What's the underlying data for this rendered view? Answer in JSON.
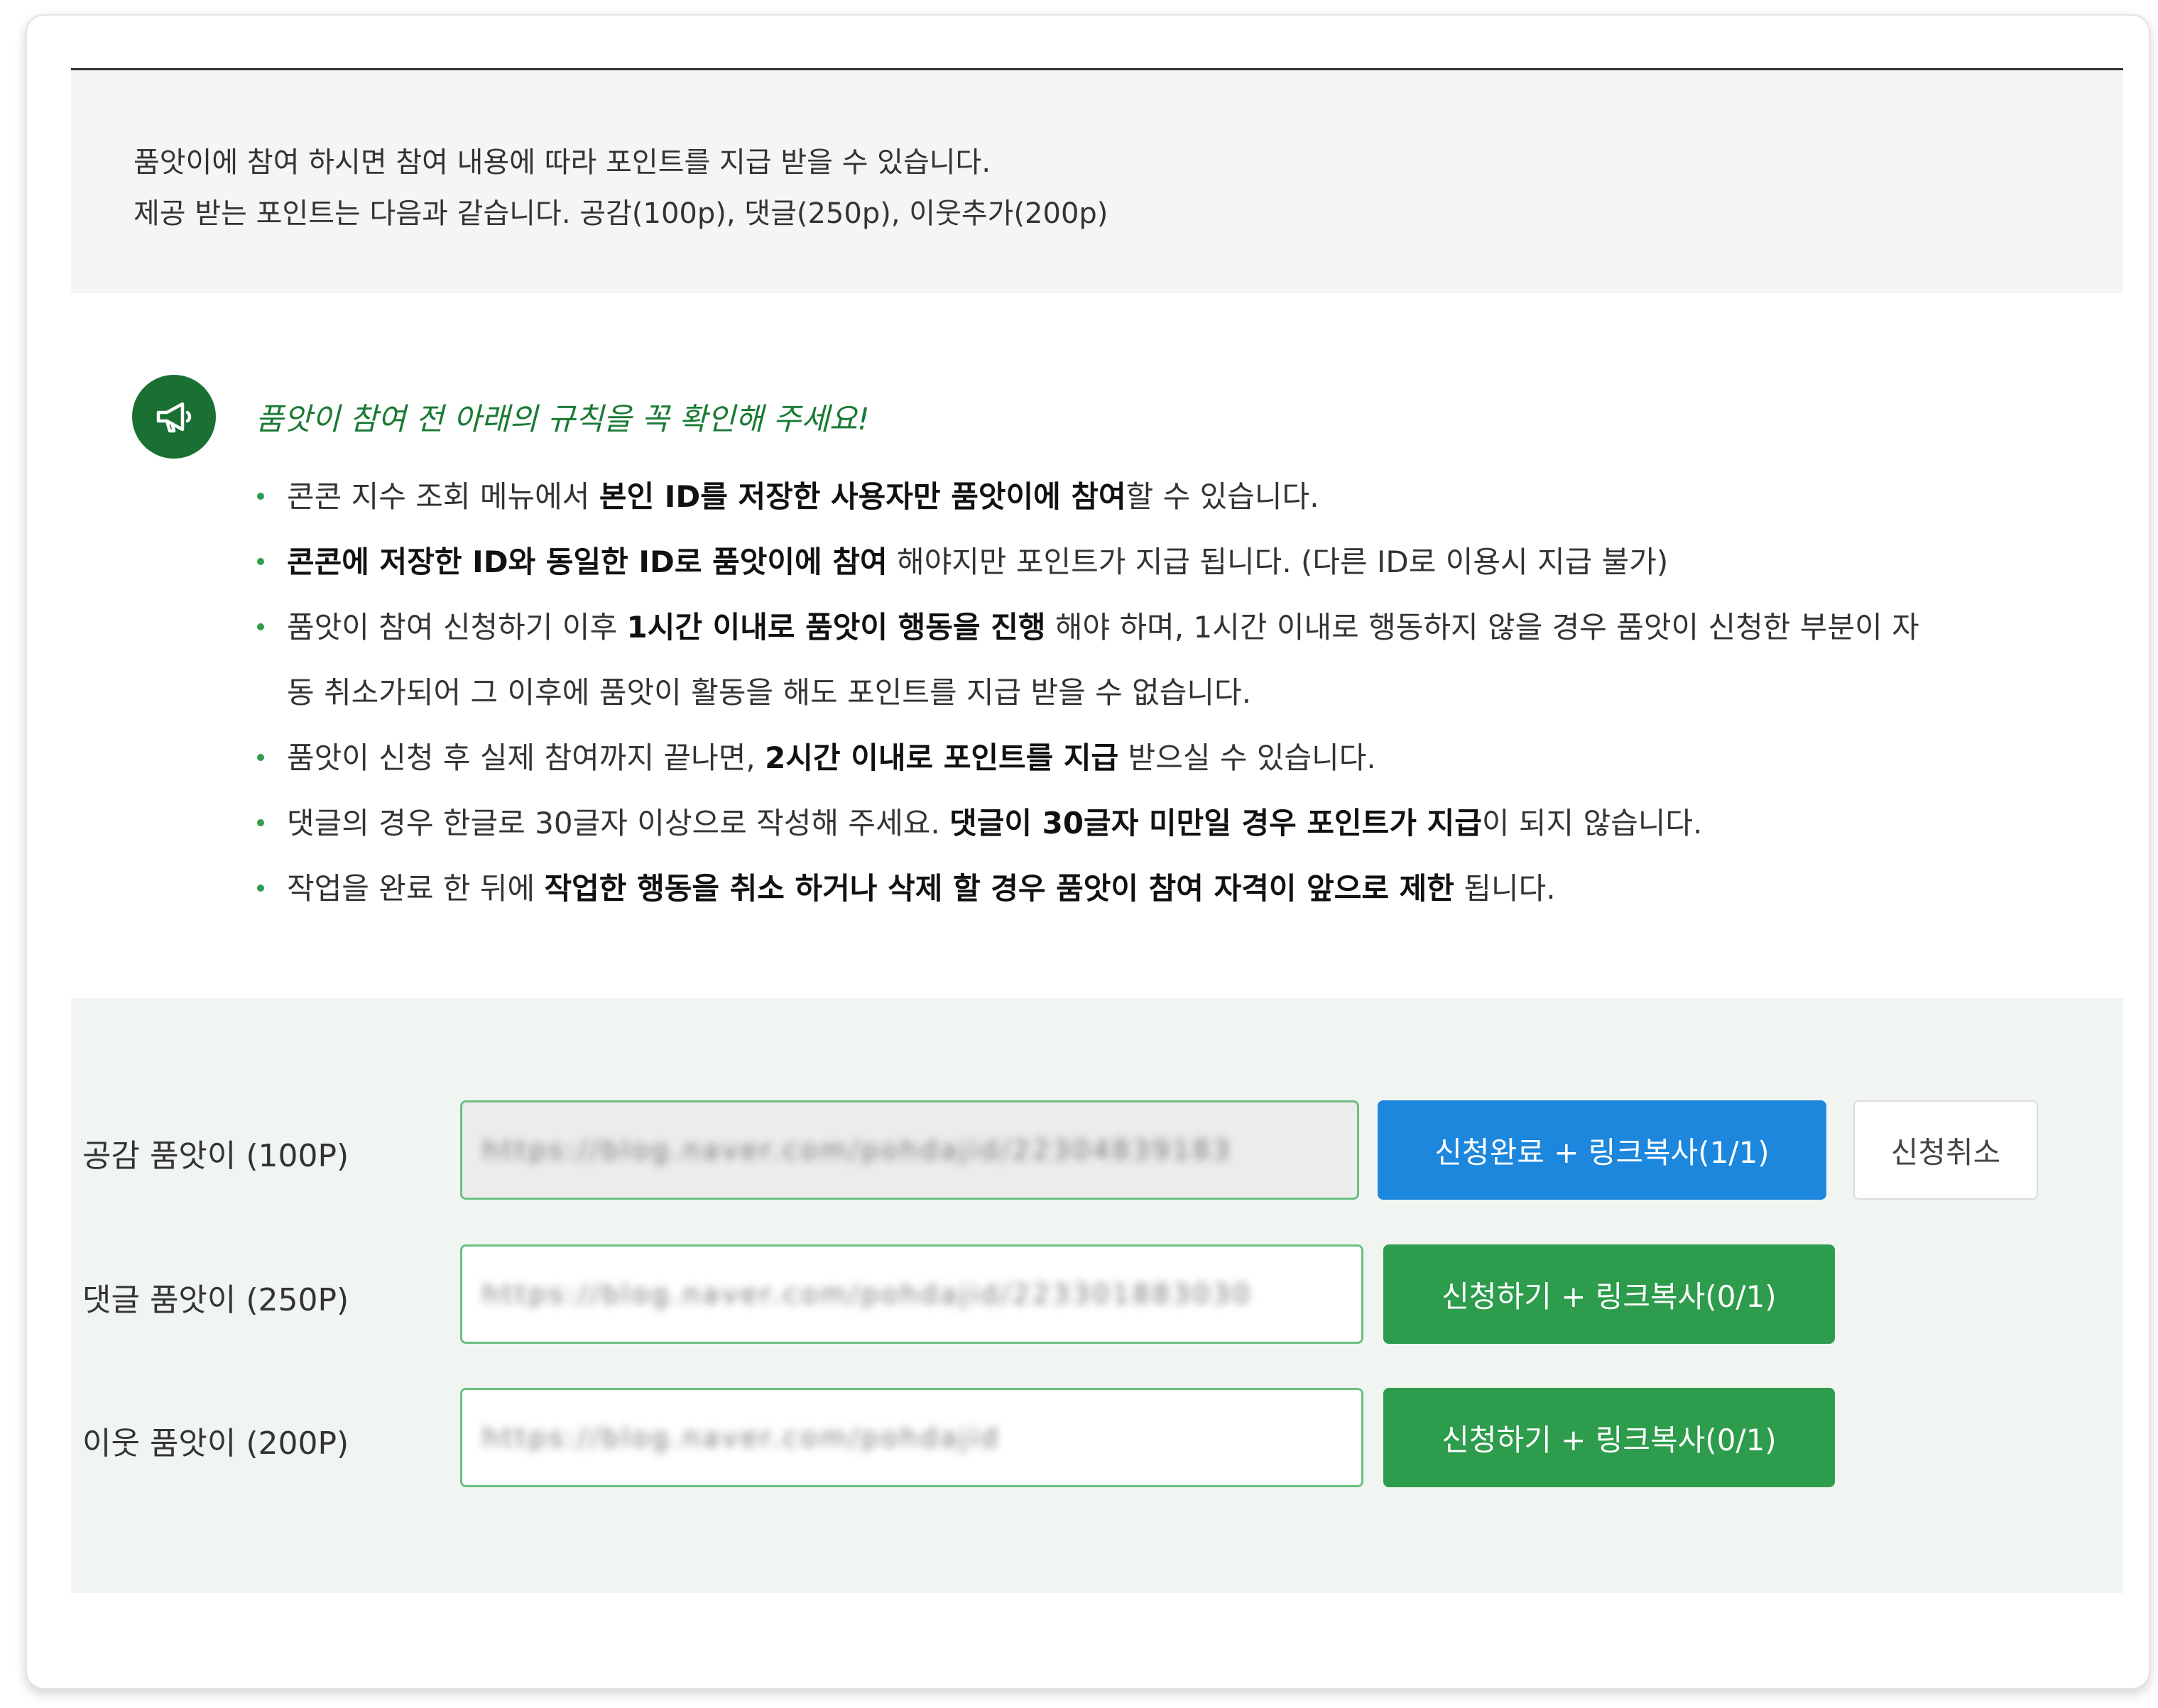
{
  "notice": {
    "line1": "품앗이에 참여 하시면 참여 내용에 따라 포인트를 지급 받을 수 있습니다.",
    "line2": "제공 받는 포인트는 다음과 같습니다. 공감(100p), 댓글(250p), 이웃추가(200p)"
  },
  "rules": {
    "title": "품앗이 참여 전 아래의 규칙을 꼭 확인해 주세요!",
    "icon": "megaphone-icon",
    "items": [
      [
        {
          "t": "콘콘 지수 조회 메뉴에서 ",
          "b": false
        },
        {
          "t": "본인 ID를 저장한 사용자만 품앗이에 참여",
          "b": true
        },
        {
          "t": "할 수 있습니다.",
          "b": false
        }
      ],
      [
        {
          "t": "콘콘에 저장한 ID와 동일한 ID로 품앗이에 참여",
          "b": true
        },
        {
          "t": " 해야지만 포인트가 지급 됩니다. (다른 ID로 이용시 지급 불가)",
          "b": false
        }
      ],
      [
        {
          "t": "품앗이 참여 신청하기 이후 ",
          "b": false
        },
        {
          "t": "1시간 이내로 품앗이 행동을 진행",
          "b": true
        },
        {
          "t": " 해야 하며, 1시간 이내로 행동하지 않을 경우 품앗이 신청한 부분이 자",
          "b": false
        },
        {
          "br": true
        },
        {
          "t": "동 취소가되어 그 이후에 품앗이 활동을 해도 포인트를 지급 받을 수 없습니다.",
          "b": false
        }
      ],
      [
        {
          "t": "품앗이 신청 후 실제 참여까지 끝나면, ",
          "b": false
        },
        {
          "t": "2시간 이내로 포인트를 지급",
          "b": true
        },
        {
          "t": " 받으실 수 있습니다.",
          "b": false
        }
      ],
      [
        {
          "t": "댓글의 경우 한글로 30글자 이상으로 작성해 주세요. ",
          "b": false
        },
        {
          "t": "댓글이 30글자 미만일 경우 포인트가 지급",
          "b": true
        },
        {
          "t": "이 되지 않습니다.",
          "b": false
        }
      ],
      [
        {
          "t": "작업을 완료 한 뒤에 ",
          "b": false
        },
        {
          "t": "작업한 행동을 취소 하거나 삭제 할 경우 품앗이 참여 자격이 앞으로 제한",
          "b": true
        },
        {
          "t": " 됩니다.",
          "b": false
        }
      ]
    ]
  },
  "apply": {
    "rows": [
      {
        "label": "공감 품앗이 (100P)",
        "url": "https://blog.naver.com/pohdajid/22304839183",
        "button": "신청완료 + 링크복사(1/1)",
        "cancel": "신청취소",
        "state": "done"
      },
      {
        "label": "댓글 품앗이 (250P)",
        "url": "https://blog.naver.com/pohdajid/223301883030",
        "button": "신청하기 + 링크복사(0/1)",
        "state": "open"
      },
      {
        "label": "이웃 품앗이 (200P)",
        "url": "https://blog.naver.com/pohdajid",
        "button": "신청하기 + 링크복사(0/1)",
        "state": "open"
      }
    ]
  },
  "colors": {
    "accent_green": "#2d9c4c",
    "done_blue": "#1c87dd",
    "title_green": "#1a7a35"
  }
}
